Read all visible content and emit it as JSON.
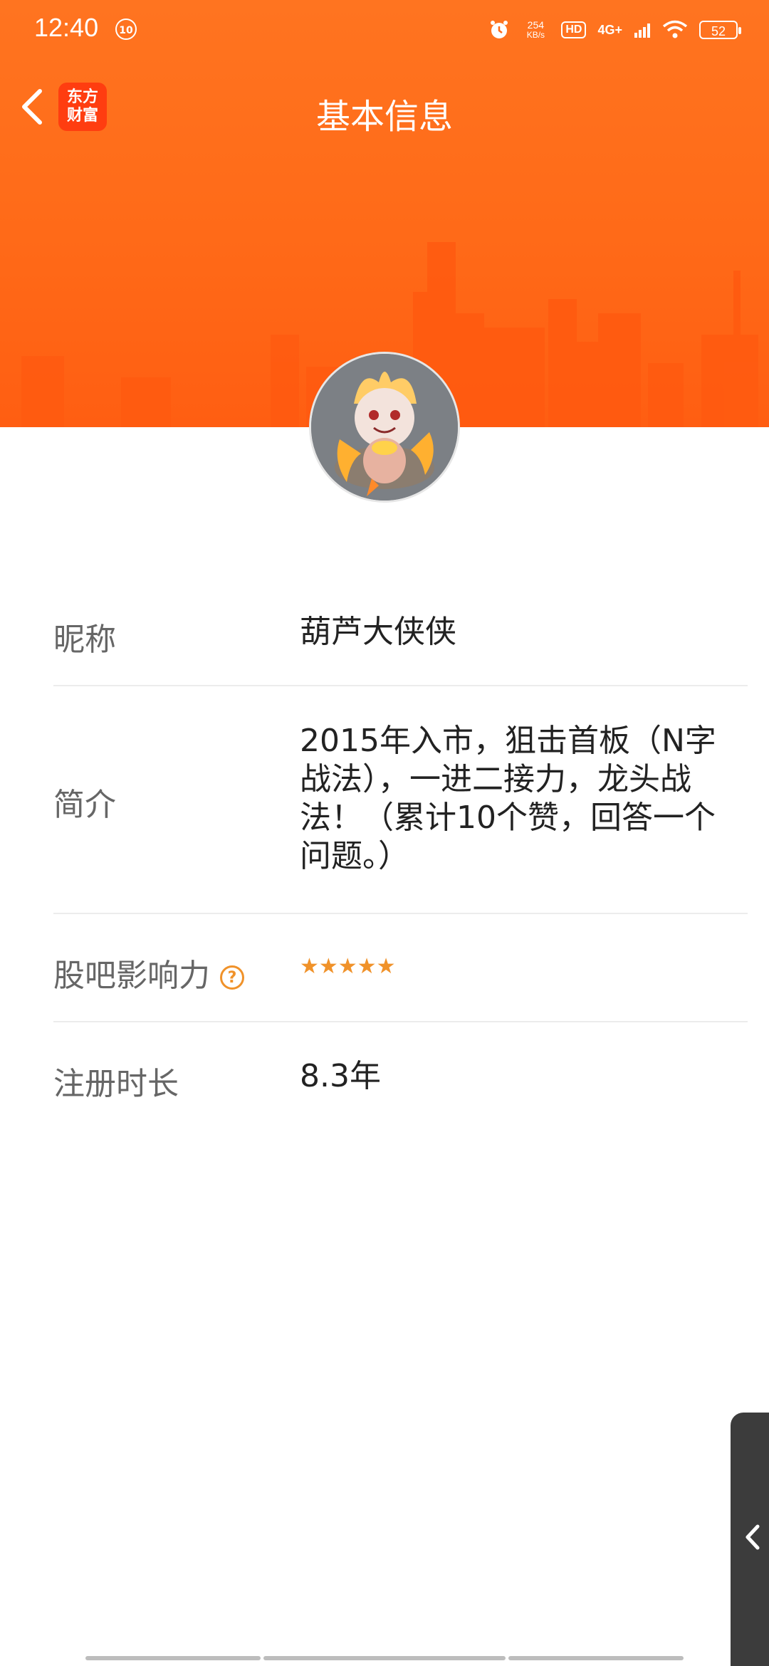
{
  "status_bar": {
    "time": "12:40",
    "notif_count": "10",
    "speed_value": "254",
    "speed_unit": "KB/s",
    "hd": "HD",
    "network": "4G+",
    "battery": "52"
  },
  "nav": {
    "logo_line1": "东方",
    "logo_line2": "财富",
    "title": "基本信息"
  },
  "profile": {
    "rows": [
      {
        "label": "昵称",
        "value": "葫芦大侠侠"
      },
      {
        "label": "简介",
        "value": "2015年入市，狙击首板（N字战法），一进二接力，龙头战法！（累计10个赞，回答一个问题。）"
      },
      {
        "label": "股吧影响力",
        "value": "★★★★★",
        "rating": 5,
        "rating_max": 5
      },
      {
        "label": "注册时长",
        "value": "8.3年"
      }
    ]
  },
  "colors": {
    "brand_orange": "#ff6a18",
    "star": "#f0922a",
    "label_gray": "#666666"
  }
}
